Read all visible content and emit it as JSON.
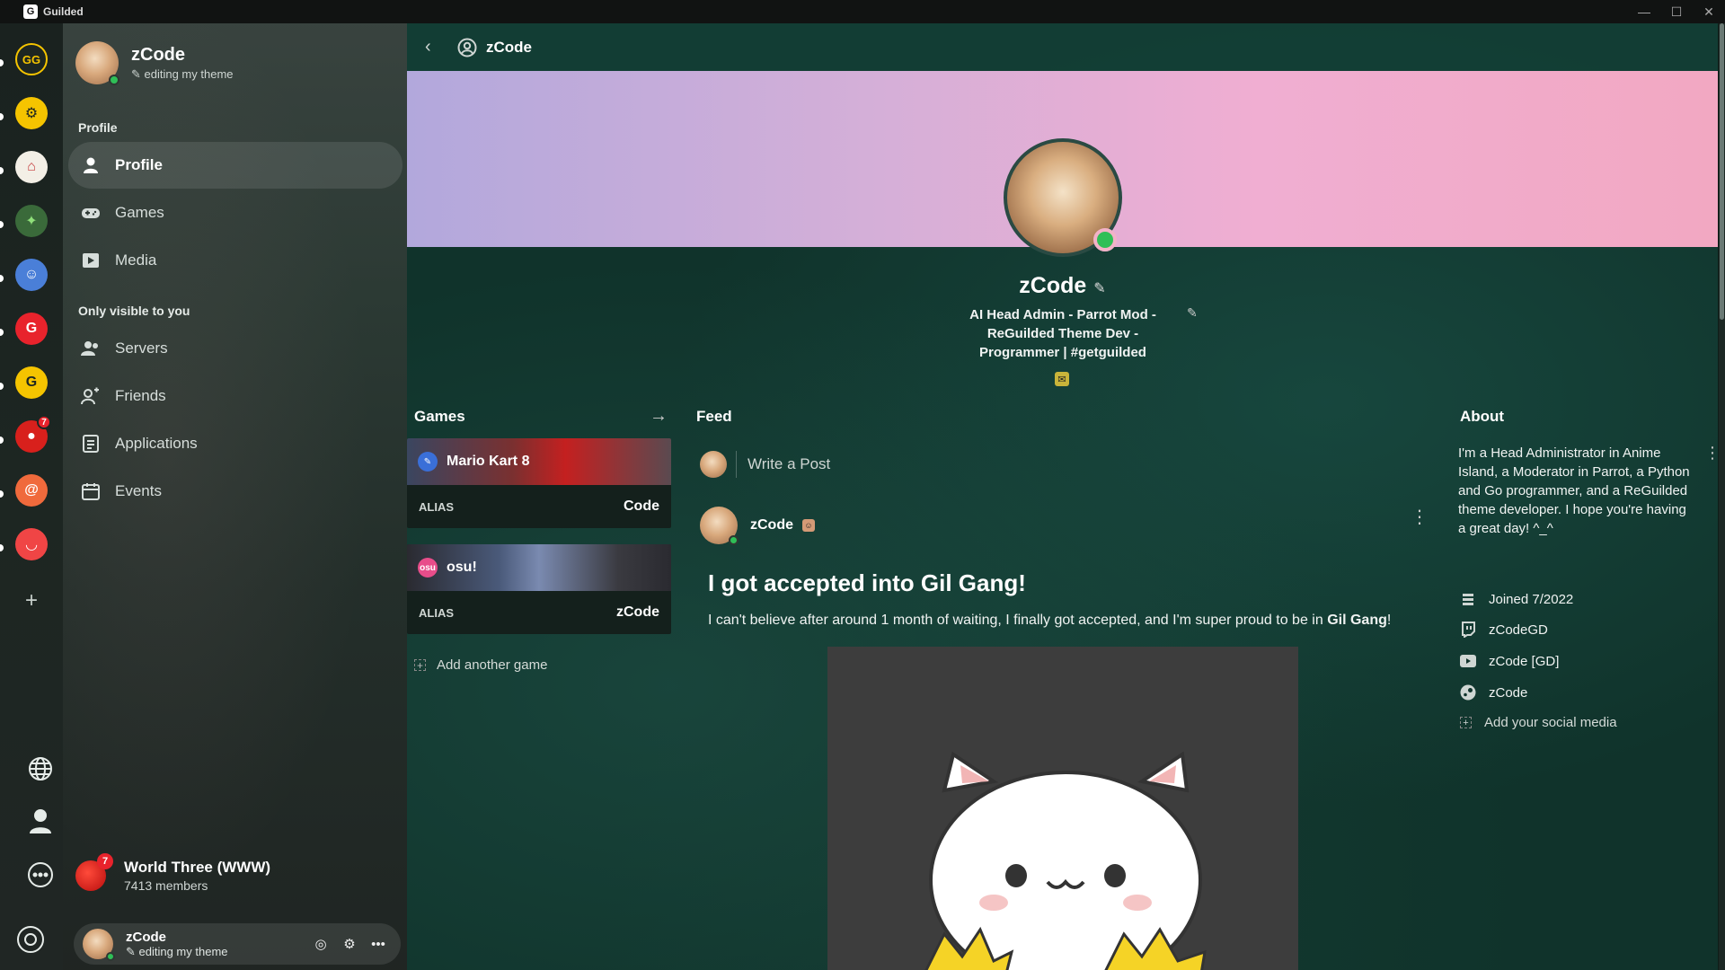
{
  "window": {
    "app_title": "Guilded"
  },
  "rail": {
    "servers": [
      {
        "name": "GG",
        "color": "#f5c400",
        "glyph": "GG"
      },
      {
        "name": "G gear",
        "color": "#f5c400",
        "glyph": "⚙"
      },
      {
        "name": "red house",
        "color": "#f3efe6",
        "glyph": "⌂"
      },
      {
        "name": "parrot",
        "color": "#2c7d3a",
        "glyph": "✦"
      },
      {
        "name": "anime",
        "color": "#4a7fd8",
        "glyph": "☺"
      },
      {
        "name": "guilded red",
        "color": "#e8232c",
        "glyph": "G"
      },
      {
        "name": "guilded yellow",
        "color": "#f5c400",
        "glyph": "G"
      },
      {
        "name": "red ball",
        "color": "#d8201c",
        "glyph": "●",
        "badge": "7"
      },
      {
        "name": "spiral",
        "color": "#f06a3c",
        "glyph": "@"
      },
      {
        "name": "cat",
        "color": "#f04545",
        "glyph": "◡"
      }
    ]
  },
  "sidebar": {
    "user": {
      "name": "zCode",
      "status": "editing my theme"
    },
    "section_profile": "Profile",
    "items": [
      {
        "label": "Profile",
        "icon": "person-icon"
      },
      {
        "label": "Games",
        "icon": "gamepad-icon"
      },
      {
        "label": "Media",
        "icon": "media-icon"
      }
    ],
    "section_private": "Only visible to you",
    "private_items": [
      {
        "label": "Servers",
        "icon": "servers-icon"
      },
      {
        "label": "Friends",
        "icon": "friends-icon"
      },
      {
        "label": "Applications",
        "icon": "applications-icon"
      },
      {
        "label": "Events",
        "icon": "calendar-icon"
      }
    ],
    "server_card": {
      "name": "World Three (WWW)",
      "members": "7413 members",
      "badge": "7"
    },
    "bottom_user": {
      "name": "zCode",
      "status": "editing my theme"
    }
  },
  "main": {
    "topbar_title": "zCode",
    "profile": {
      "name": "zCode",
      "bio": "AI Head Admin - Parrot Mod - ReGuilded Theme Dev - Programmer | #getguilded"
    },
    "games": {
      "title": "Games",
      "cards": [
        {
          "name": "Mario Kart 8",
          "alias_label": "ALIAS",
          "alias": "Code",
          "accent": "#c42020"
        },
        {
          "name": "osu!",
          "alias_label": "ALIAS",
          "alias": "zCode",
          "accent": "#e84d8a"
        }
      ],
      "add_label": "Add another game"
    },
    "feed": {
      "title": "Feed",
      "write_placeholder": "Write a Post",
      "post": {
        "author": "zCode",
        "title": "I got accepted into Gil Gang!",
        "body_prefix": "I can't believe after around 1 month of waiting, I finally got accepted, and I'm super proud to be in ",
        "body_bold": "Gil Gang",
        "body_suffix": "!"
      }
    },
    "about": {
      "title": "About",
      "text": "I'm a Head Administrator in Anime Island, a Moderator in Parrot, a Python and Go programmer, and a ReGuilded theme developer. I hope you're having a great day! ^_^",
      "rows": [
        {
          "label": "Joined 7/2022",
          "icon": "calendar-icon"
        },
        {
          "label": "zCodeGD",
          "icon": "twitch-icon"
        },
        {
          "label": "zCode [GD]",
          "icon": "youtube-icon"
        },
        {
          "label": "zCode",
          "icon": "steam-icon"
        }
      ],
      "add_social": "Add your social media"
    }
  }
}
